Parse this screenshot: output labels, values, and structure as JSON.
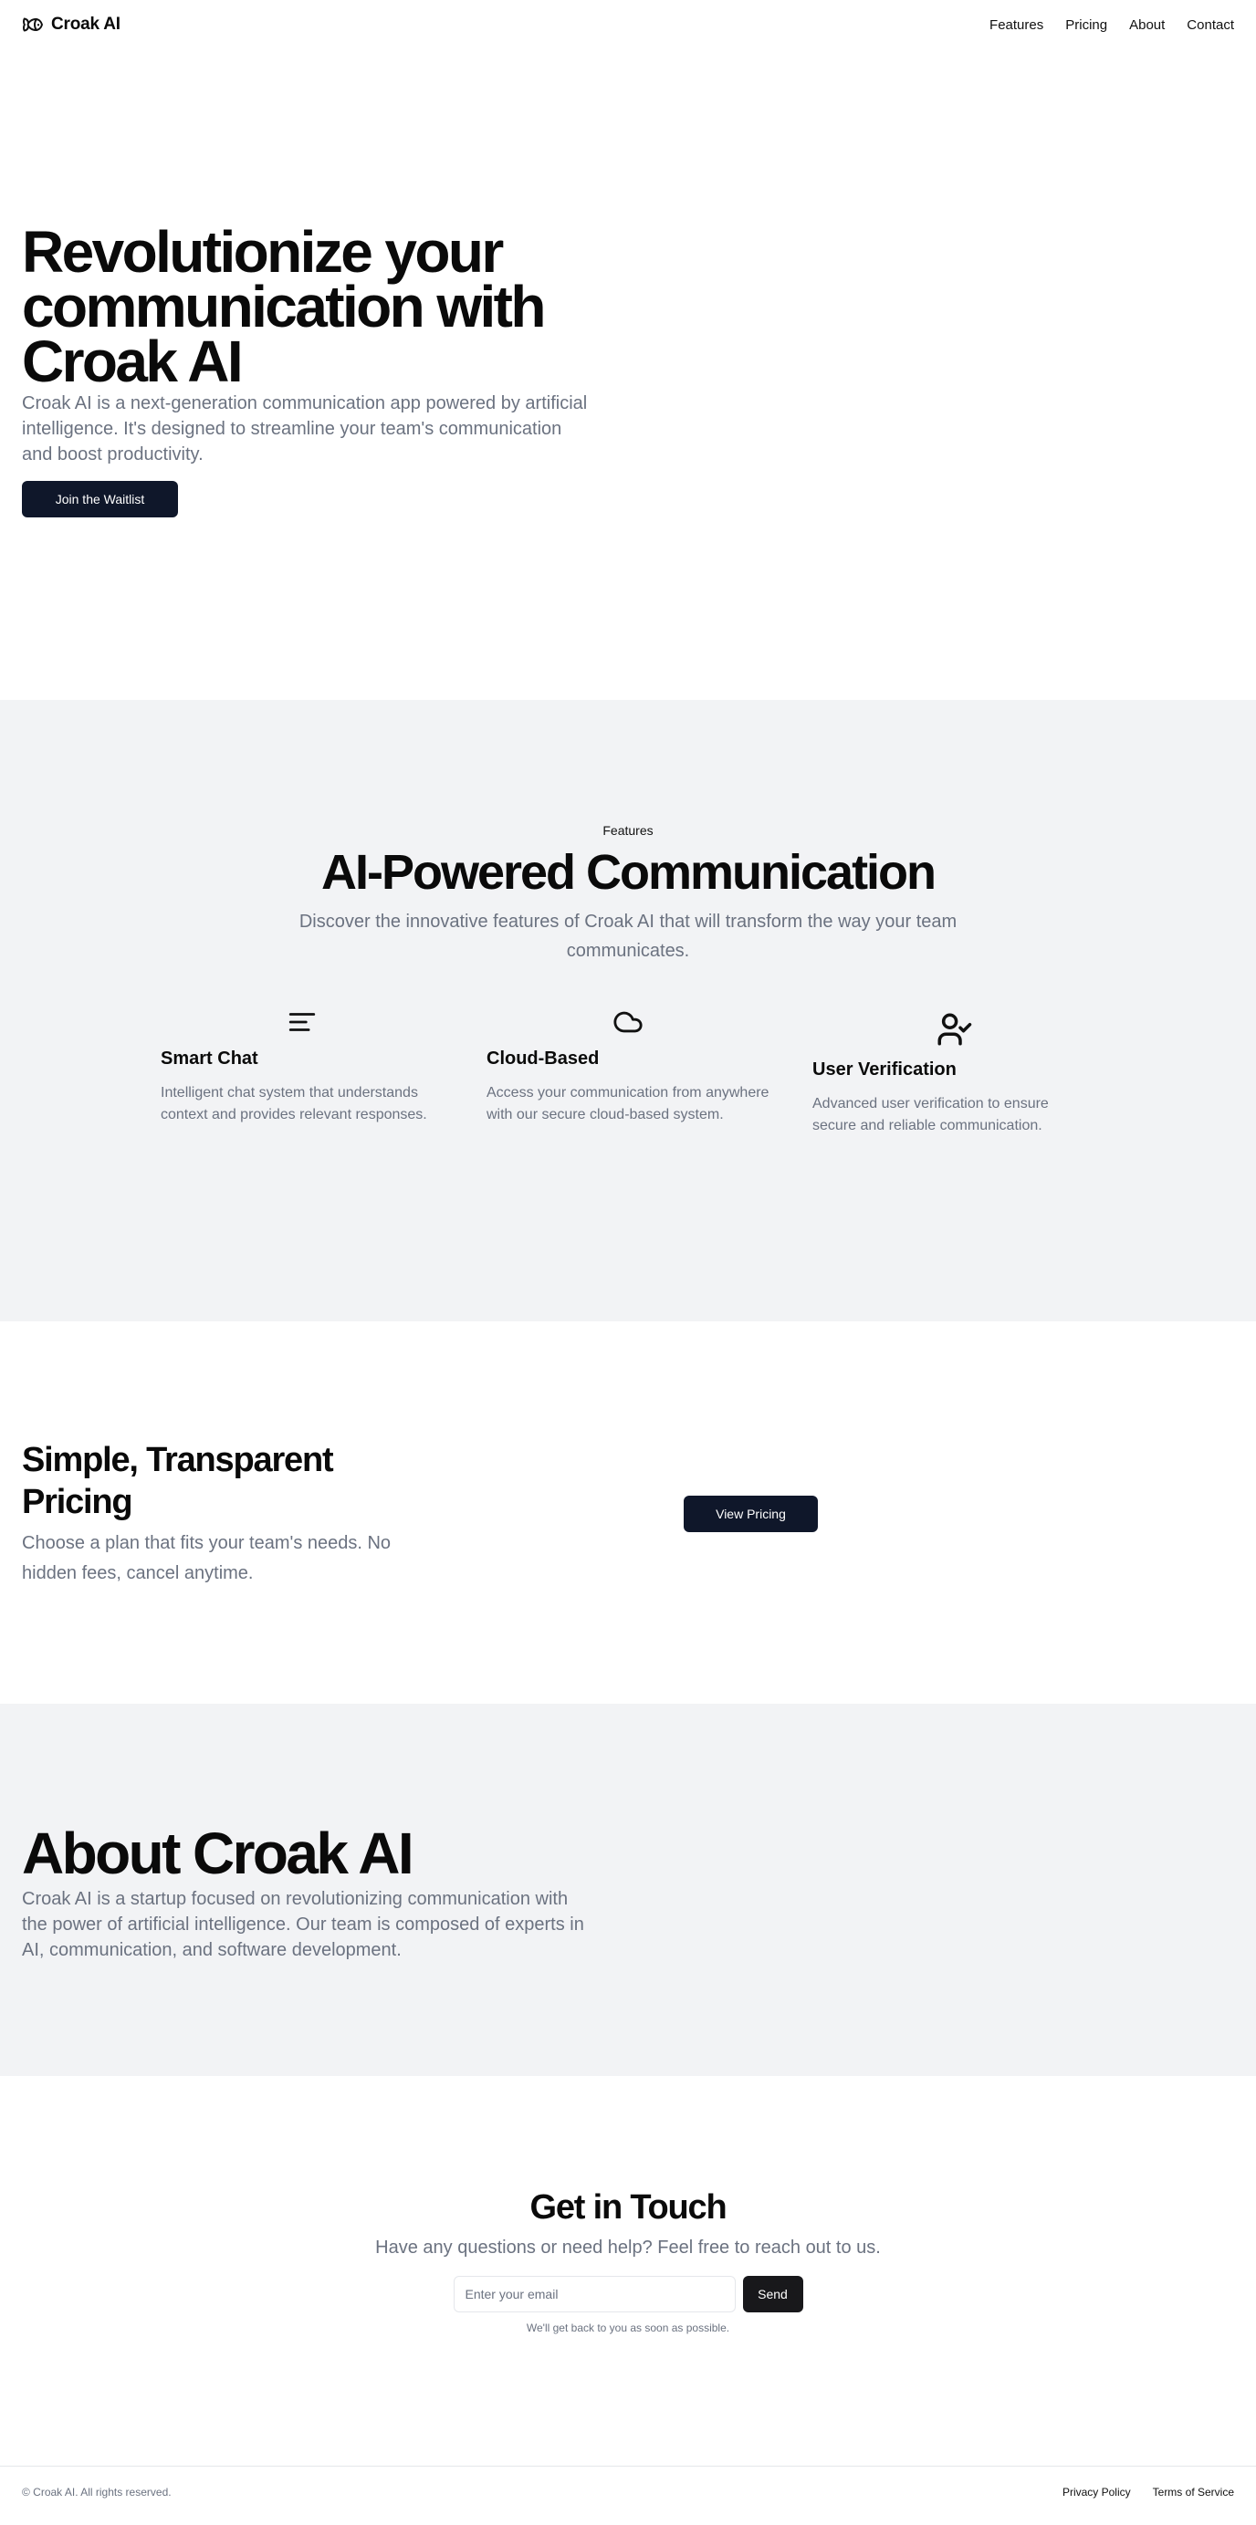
{
  "header": {
    "brand": "Croak AI",
    "brand_icon": "frog-logo-icon",
    "nav": [
      "Features",
      "Pricing",
      "About",
      "Contact"
    ]
  },
  "hero": {
    "title": "Revolutionize your communication with Croak AI",
    "subtitle": "Croak AI is a next-generation communication app powered by artificial intelligence. It's designed to streamline your team's communication and boost productivity.",
    "cta": "Join the Waitlist"
  },
  "features": {
    "eyebrow": "Features",
    "title": "AI-Powered Communication",
    "subtitle": "Discover the innovative features of Croak AI that will transform the way your team communicates.",
    "items": [
      {
        "icon": "menu-lines-icon",
        "title": "Smart Chat",
        "description": "Intelligent chat system that understands context and provides relevant responses."
      },
      {
        "icon": "cloud-icon",
        "title": "Cloud-Based",
        "description": "Access your communication from anywhere with our secure cloud-based system."
      },
      {
        "icon": "user-check-icon",
        "title": "User Verification",
        "description": "Advanced user verification to ensure secure and reliable communication."
      }
    ]
  },
  "pricing": {
    "title": "Simple, Transparent Pricing",
    "subtitle": "Choose a plan that fits your team's needs. No hidden fees, cancel anytime.",
    "cta": "View Pricing"
  },
  "about": {
    "title": "About Croak AI",
    "subtitle": "Croak AI is a startup focused on revolutionizing communication with the power of artificial intelligence. Our team is composed of experts in AI, communication, and software development."
  },
  "contact": {
    "title": "Get in Touch",
    "subtitle": "Have any questions or need help? Feel free to reach out to us.",
    "email_placeholder": "Enter your email",
    "email_value": "",
    "send": "Send",
    "note": "We'll get back to you as soon as possible."
  },
  "footer": {
    "copyright": "© Croak AI. All rights reserved.",
    "links": [
      "Privacy Policy",
      "Terms of Service"
    ]
  },
  "colors": {
    "primary_button": "#0f172a",
    "section_alt_bg": "#f2f3f5",
    "muted_text": "#6b7280"
  }
}
